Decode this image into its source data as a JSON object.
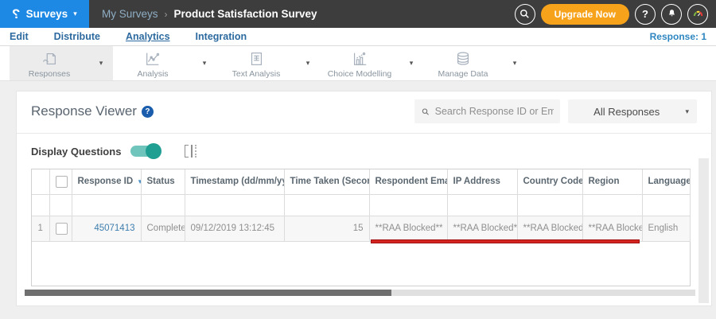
{
  "topbar": {
    "logo_glyph": "?",
    "product_menu_label": "Surveys",
    "breadcrumb_parent": "My Surveys",
    "breadcrumb_current": "Product Satisfaction Survey",
    "upgrade_button_label": "Upgrade Now",
    "help_button_glyph": "?"
  },
  "nav": {
    "items": [
      {
        "label": "Edit",
        "active": false
      },
      {
        "label": "Distribute",
        "active": false
      },
      {
        "label": "Analytics",
        "active": true
      },
      {
        "label": "Integration",
        "active": false
      }
    ],
    "response_count_label": "Response: 1"
  },
  "toolbar": {
    "items": [
      {
        "label": "Responses",
        "icon": "responses-icon",
        "active": true
      },
      {
        "label": "Analysis",
        "icon": "analysis-icon",
        "active": false
      },
      {
        "label": "Text Analysis",
        "icon": "text-analysis-icon",
        "active": false
      },
      {
        "label": "Choice Modelling",
        "icon": "choice-modelling-icon",
        "active": false
      },
      {
        "label": "Manage Data",
        "icon": "manage-data-icon",
        "active": false
      }
    ]
  },
  "viewer": {
    "title": "Response Viewer",
    "help_glyph": "?",
    "search_placeholder": "Search Response ID or Email",
    "responses_filter_value": "All Responses",
    "display_questions_label": "Display Questions",
    "display_questions_on": true
  },
  "table": {
    "columns": [
      {
        "label": "Response ID",
        "sort": "desc"
      },
      {
        "label": "Status",
        "sort": "none"
      },
      {
        "label": "Timestamp (dd/mm/yyyy)",
        "sort": "both"
      },
      {
        "label": "Time Taken (Seconds)",
        "sort": "both"
      },
      {
        "label": "Respondent Email",
        "sort": "none"
      },
      {
        "label": "IP Address",
        "sort": "none"
      },
      {
        "label": "Country Code",
        "sort": "none"
      },
      {
        "label": "Region",
        "sort": "none"
      },
      {
        "label": "Language",
        "sort": "none"
      }
    ],
    "rows": [
      {
        "index": "1",
        "response_id": "45071413",
        "status": "Completed",
        "timestamp": "09/12/2019 13:12:45",
        "time_taken": "15",
        "respondent_email": "**RAA Blocked**",
        "ip_address": "**RAA Blocked**",
        "country_code": "**RAA Blocked**",
        "region": "**RAA Blocked**",
        "language": "English"
      }
    ]
  },
  "ui": {
    "caret": "▾",
    "sort_desc_glyph": "▼",
    "sort_both_glyph": "⇅",
    "breadcrumb_separator": "›"
  },
  "colors": {
    "topbar_dark": "#3D3D3D",
    "brand_blue": "#1E88E5",
    "upgrade_orange": "#F7A21B",
    "nav_link_blue": "#2D6A9F",
    "response_count_blue": "#2E86C1",
    "toggle_teal": "#26A69A",
    "annotation_red": "#D42420",
    "value_link_blue": "#3F7EAE"
  }
}
